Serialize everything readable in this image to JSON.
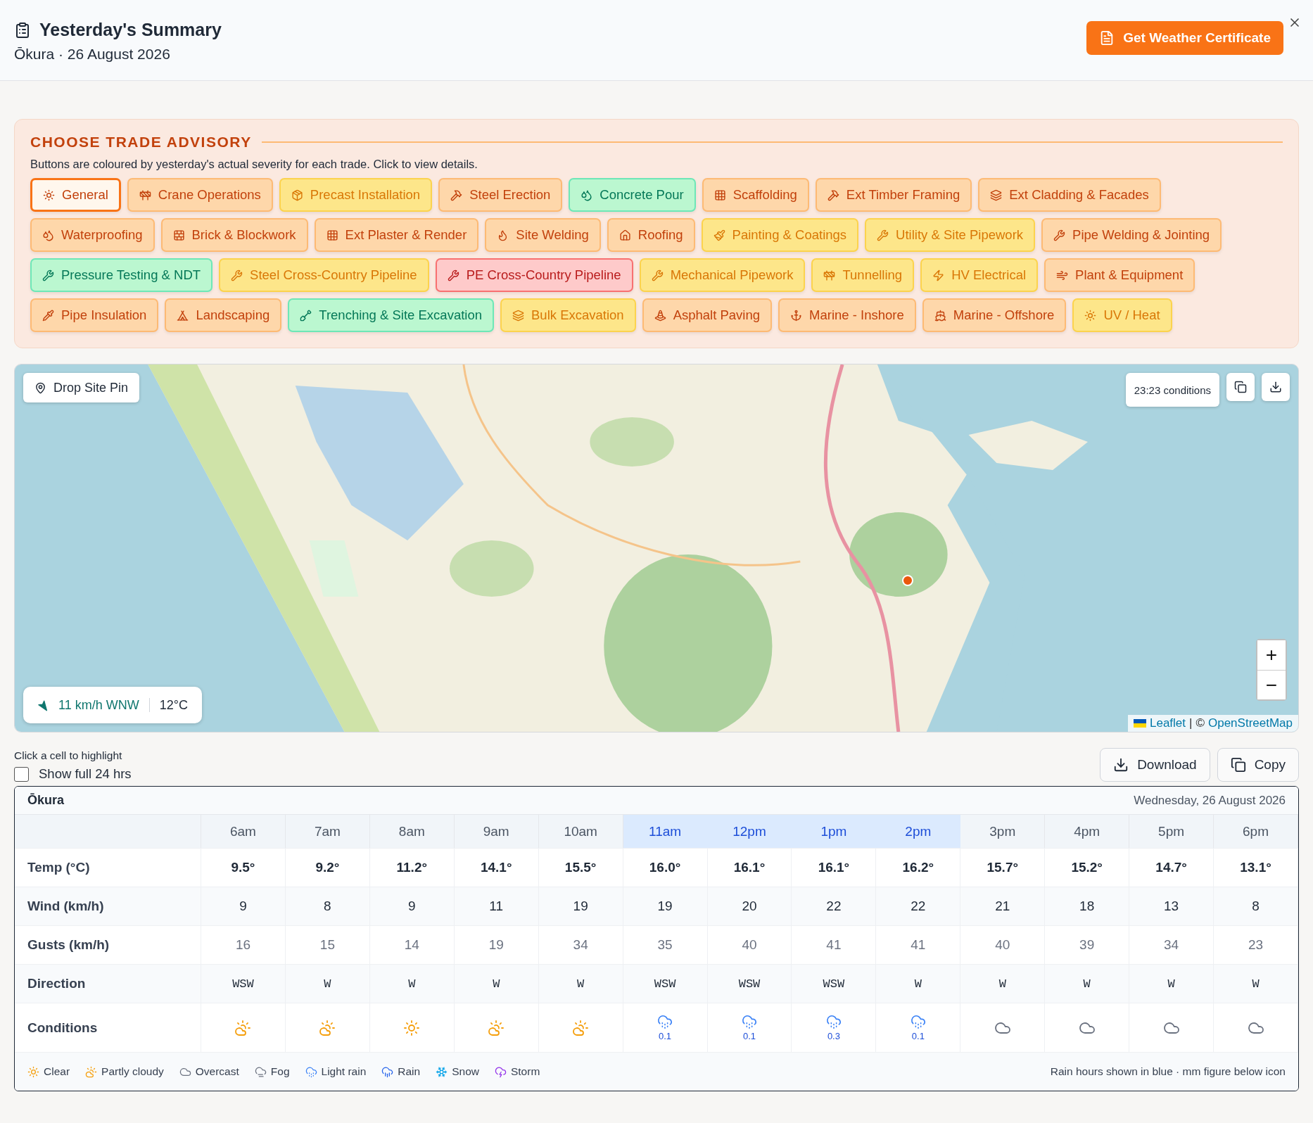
{
  "header": {
    "title": "Yesterday's Summary",
    "subtitle": "Ōkura · 26 August 2026",
    "certificate_button": "Get Weather Certificate"
  },
  "advisory": {
    "title": "CHOOSE TRADE ADVISORY",
    "hint": "Buttons are coloured by yesterday's actual severity for each trade. Click to view details.",
    "trades": [
      {
        "label": "General",
        "color": "#f97316",
        "selected": true
      },
      {
        "label": "Crane Operations",
        "color": "#fdba74",
        "selected": false
      },
      {
        "label": "Precast Installation",
        "color": "#fcd34d",
        "selected": false
      },
      {
        "label": "Steel Erection",
        "color": "#fdba74",
        "selected": false
      },
      {
        "label": "Concrete Pour",
        "color": "#6ee7b7",
        "selected": false
      },
      {
        "label": "Scaffolding",
        "color": "#fdba74",
        "selected": false
      },
      {
        "label": "Ext Timber Framing",
        "color": "#fdba74",
        "selected": false
      },
      {
        "label": "Ext Cladding & Facades",
        "color": "#fdba74",
        "selected": false
      },
      {
        "label": "Waterproofing",
        "color": "#fdba74",
        "selected": false
      },
      {
        "label": "Brick & Blockwork",
        "color": "#fdba74",
        "selected": false
      },
      {
        "label": "Ext Plaster & Render",
        "color": "#fdba74",
        "selected": false
      },
      {
        "label": "Site Welding",
        "color": "#fdba74",
        "selected": false
      },
      {
        "label": "Roofing",
        "color": "#fdba74",
        "selected": false
      },
      {
        "label": "Painting & Coatings",
        "color": "#fcd34d",
        "selected": false
      },
      {
        "label": "Utility & Site Pipework",
        "color": "#fcd34d",
        "selected": false
      },
      {
        "label": "Pipe Welding & Jointing",
        "color": "#fdba74",
        "selected": false
      },
      {
        "label": "Pressure Testing & NDT",
        "color": "#6ee7b7",
        "selected": false
      },
      {
        "label": "Steel Cross-Country Pipeline",
        "color": "#fcd34d",
        "selected": false
      },
      {
        "label": "PE Cross-Country Pipeline",
        "color": "#f87171",
        "selected": false
      },
      {
        "label": "Mechanical Pipework",
        "color": "#fcd34d",
        "selected": false
      },
      {
        "label": "Tunnelling",
        "color": "#fcd34d",
        "selected": false
      },
      {
        "label": "HV Electrical",
        "color": "#fcd34d",
        "selected": false
      },
      {
        "label": "Plant & Equipment",
        "color": "#fdba74",
        "selected": false
      },
      {
        "label": "Pipe Insulation",
        "color": "#fdba74",
        "selected": false
      },
      {
        "label": "Landscaping",
        "color": "#fdba74",
        "selected": false
      },
      {
        "label": "Trenching & Site Excavation",
        "color": "#6ee7b7",
        "selected": false
      },
      {
        "label": "Bulk Excavation",
        "color": "#fcd34d",
        "selected": false
      },
      {
        "label": "Asphalt Paving",
        "color": "#fdba74",
        "selected": false
      },
      {
        "label": "Marine - Inshore",
        "color": "#fdba74",
        "selected": false
      },
      {
        "label": "Marine - Offshore",
        "color": "#fdba74",
        "selected": false
      },
      {
        "label": "UV / Heat",
        "color": "#fcd34d",
        "selected": false
      }
    ]
  },
  "map": {
    "pin_button": "Drop Site Pin",
    "conditions_time": "23:23 conditions",
    "wind": "11 km/h WNW",
    "temperature": "12°C",
    "zoom_in": "+",
    "zoom_out": "−",
    "attribution": {
      "link": "Leaflet",
      "separator": "|",
      "copyright": "©",
      "source": "OpenStreetMap"
    }
  },
  "table_controls": {
    "hint": "Click a cell to highlight",
    "show_full_24": {
      "label": "Show full 24 hrs",
      "checked": false
    },
    "download": "Download",
    "copy": "Copy"
  },
  "forecast": {
    "location": "Ōkura",
    "date": "Wednesday, 26 August 2026",
    "hours": [
      {
        "label": "6am",
        "highlighted": false
      },
      {
        "label": "7am",
        "highlighted": false
      },
      {
        "label": "8am",
        "highlighted": false
      },
      {
        "label": "9am",
        "highlighted": false
      },
      {
        "label": "10am",
        "highlighted": false
      },
      {
        "label": "11am",
        "highlighted": true
      },
      {
        "label": "12pm",
        "highlighted": true
      },
      {
        "label": "1pm",
        "highlighted": true
      },
      {
        "label": "2pm",
        "highlighted": true
      },
      {
        "label": "3pm",
        "highlighted": false
      },
      {
        "label": "4pm",
        "highlighted": false
      },
      {
        "label": "5pm",
        "highlighted": false
      },
      {
        "label": "6pm",
        "highlighted": false
      }
    ],
    "rows": [
      {
        "kind": "temp",
        "label": "Temp (°C)",
        "values": [
          "9.5°",
          "9.2°",
          "11.2°",
          "14.1°",
          "15.5°",
          "16.0°",
          "16.1°",
          "16.1°",
          "16.2°",
          "15.7°",
          "15.2°",
          "14.7°",
          "13.1°"
        ]
      },
      {
        "kind": "wind",
        "label": "Wind (km/h)",
        "values": [
          "9",
          "8",
          "9",
          "11",
          "19",
          "19",
          "20",
          "22",
          "22",
          "21",
          "18",
          "13",
          "8"
        ]
      },
      {
        "kind": "gusts",
        "label": "Gusts (km/h)",
        "values": [
          "16",
          "15",
          "14",
          "19",
          "34",
          "35",
          "40",
          "41",
          "41",
          "40",
          "39",
          "34",
          "23"
        ]
      },
      {
        "kind": "direction",
        "label": "Direction",
        "values": [
          "WSW",
          "W",
          "W",
          "W",
          "W",
          "WSW",
          "WSW",
          "WSW",
          "W",
          "W",
          "W",
          "W",
          "W"
        ]
      },
      {
        "kind": "conditions",
        "label": "Conditions",
        "cells": [
          {
            "kind": "partly_cloudy"
          },
          {
            "kind": "partly_cloudy"
          },
          {
            "kind": "clear"
          },
          {
            "kind": "partly_cloudy"
          },
          {
            "kind": "partly_cloudy"
          },
          {
            "kind": "light_rain",
            "rain": "0.1"
          },
          {
            "kind": "light_rain",
            "rain": "0.1"
          },
          {
            "kind": "light_rain",
            "rain": "0.3"
          },
          {
            "kind": "light_rain",
            "rain": "0.1"
          },
          {
            "kind": "overcast"
          },
          {
            "kind": "overcast"
          },
          {
            "kind": "overcast"
          },
          {
            "kind": "overcast"
          }
        ]
      }
    ],
    "legend": [
      {
        "kind": "clear",
        "label": "Clear"
      },
      {
        "kind": "partly_cloudy",
        "label": "Partly cloudy"
      },
      {
        "kind": "overcast",
        "label": "Overcast"
      },
      {
        "kind": "fog",
        "label": "Fog"
      },
      {
        "kind": "light_rain",
        "label": "Light rain"
      },
      {
        "kind": "rain",
        "label": "Rain"
      },
      {
        "kind": "snow",
        "label": "Snow"
      },
      {
        "kind": "storm",
        "label": "Storm"
      }
    ],
    "note": "Rain hours shown in blue · mm figure below icon"
  }
}
